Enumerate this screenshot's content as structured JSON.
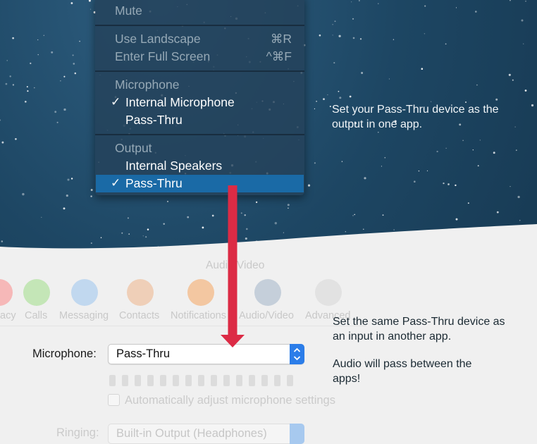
{
  "menu": {
    "mute": "Mute",
    "use_landscape": "Use Landscape",
    "use_landscape_shortcut": "⌘R",
    "enter_full_screen": "Enter Full Screen",
    "enter_full_screen_shortcut": "^⌘F",
    "microphone_header": "Microphone",
    "mic_internal": "Internal Microphone",
    "mic_passthru": "Pass-Thru",
    "output_header": "Output",
    "out_internal": "Internal Speakers",
    "out_passthru": "Pass-Thru",
    "checkmark": "✓"
  },
  "notes": {
    "output_note": "Set your Pass-Thru device as the output in one app.",
    "input_note": "Set the same Pass-Thru device as an input in another app.",
    "pass_note": "Audio will pass between the apps!"
  },
  "prefs": {
    "window_title": "Audio/Video",
    "tabs": [
      {
        "label": "acy",
        "color": "#f6b8b8"
      },
      {
        "label": "Calls",
        "color": "#c4e6b7"
      },
      {
        "label": "Messaging",
        "color": "#c1d8ef"
      },
      {
        "label": "Contacts",
        "color": "#efcfb8"
      },
      {
        "label": "Notifications",
        "color": "#f3c7a1"
      },
      {
        "label": "Audio/Video",
        "color": "#c5cfda"
      },
      {
        "label": "Advanced",
        "color": "#e2e2e2"
      }
    ],
    "microphone_label": "Microphone:",
    "microphone_value": "Pass-Thru",
    "auto_adjust": "Automatically adjust microphone settings",
    "ringing_label": "Ringing:",
    "ringing_value": "Built-in Output (Headphones)"
  },
  "colors": {
    "arrow": "#dc2b45",
    "menu_highlight": "#1a6aa6",
    "popup_accent": "#2b7de9"
  }
}
